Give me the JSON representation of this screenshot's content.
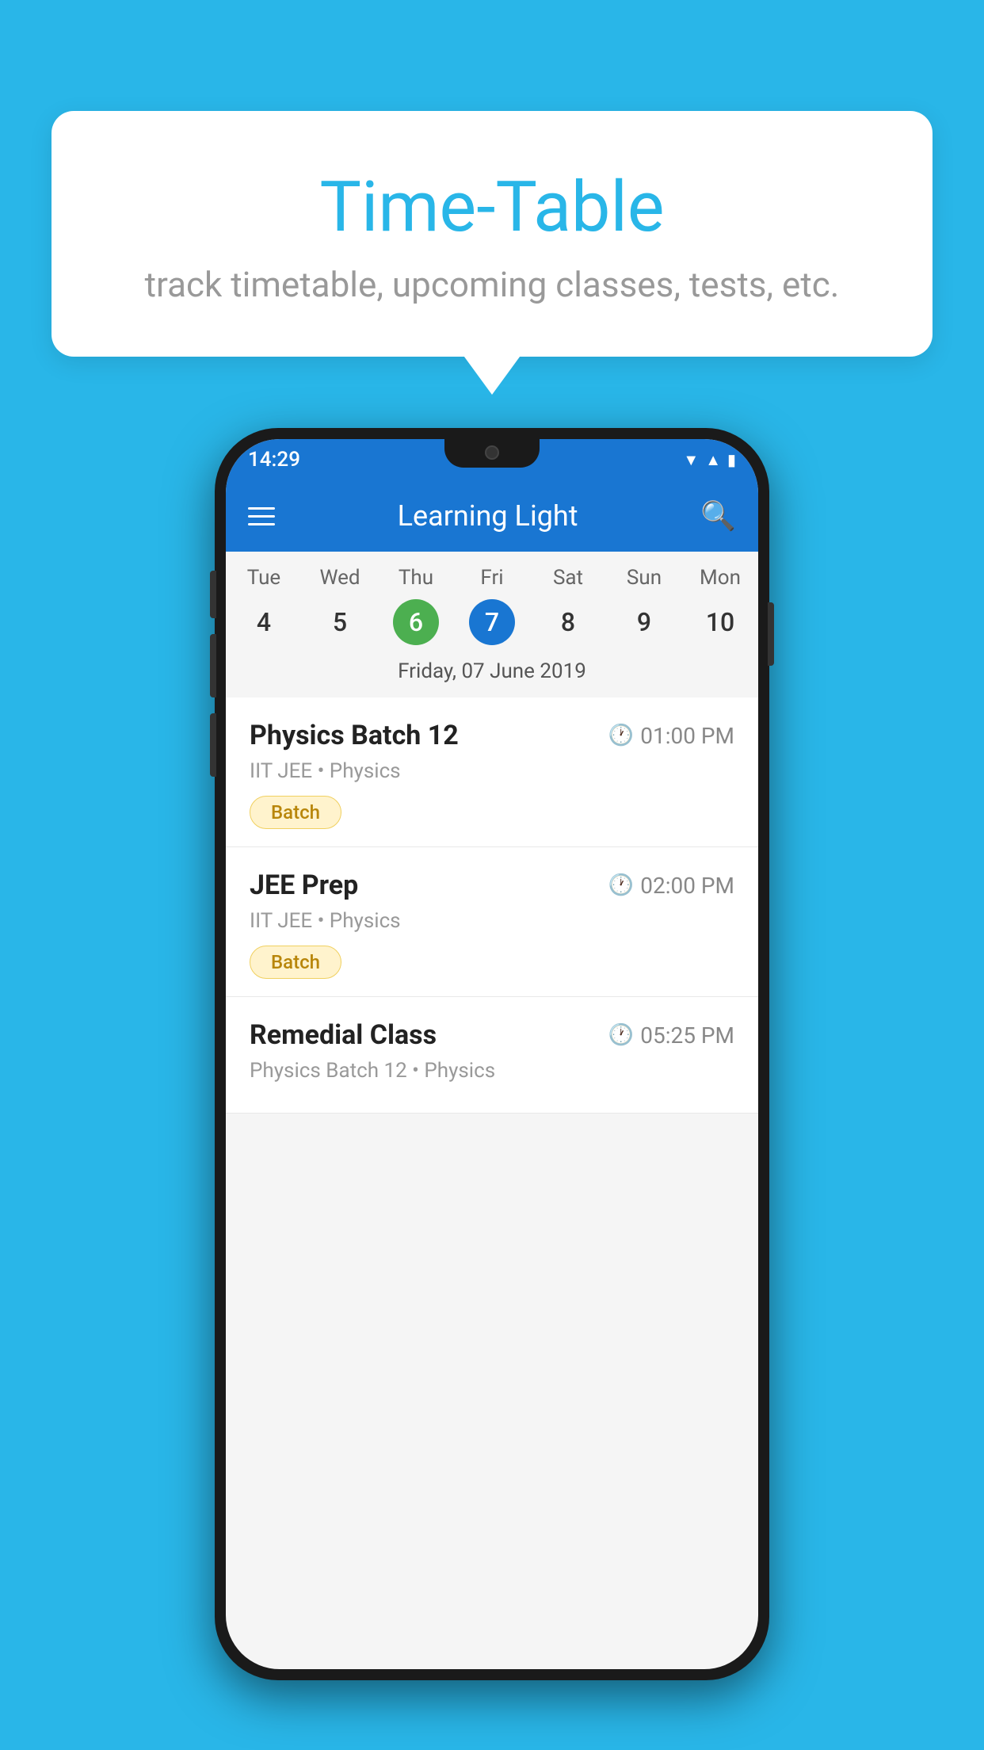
{
  "background_color": "#29b6e8",
  "bubble": {
    "title": "Time-Table",
    "subtitle": "track timetable, upcoming classes, tests, etc."
  },
  "phone": {
    "status_bar": {
      "time": "14:29"
    },
    "app_bar": {
      "title": "Learning Light"
    },
    "calendar": {
      "days": [
        {
          "name": "Tue",
          "num": "4",
          "state": "normal"
        },
        {
          "name": "Wed",
          "num": "5",
          "state": "normal"
        },
        {
          "name": "Thu",
          "num": "6",
          "state": "today"
        },
        {
          "name": "Fri",
          "num": "7",
          "state": "selected"
        },
        {
          "name": "Sat",
          "num": "8",
          "state": "normal"
        },
        {
          "name": "Sun",
          "num": "9",
          "state": "normal"
        },
        {
          "name": "Mon",
          "num": "10",
          "state": "normal"
        }
      ],
      "selected_date": "Friday, 07 June 2019"
    },
    "schedule": [
      {
        "title": "Physics Batch 12",
        "time": "01:00 PM",
        "subtitle": "IIT JEE • Physics",
        "badge": "Batch"
      },
      {
        "title": "JEE Prep",
        "time": "02:00 PM",
        "subtitle": "IIT JEE • Physics",
        "badge": "Batch"
      },
      {
        "title": "Remedial Class",
        "time": "05:25 PM",
        "subtitle": "Physics Batch 12 • Physics",
        "badge": null
      }
    ]
  }
}
